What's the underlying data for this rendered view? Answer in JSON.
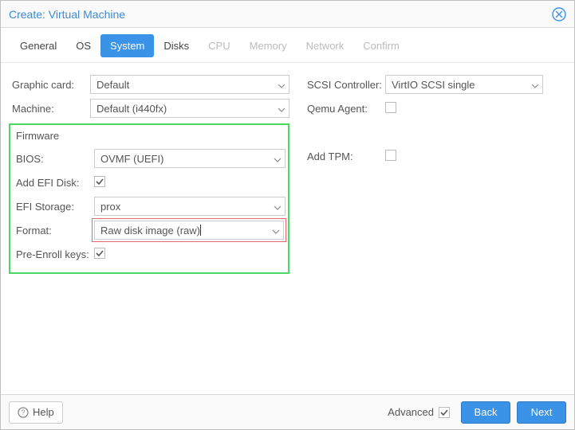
{
  "window": {
    "title": "Create: Virtual Machine"
  },
  "tabs": {
    "general": "General",
    "os": "OS",
    "system": "System",
    "disks": "Disks",
    "cpu": "CPU",
    "memory": "Memory",
    "network": "Network",
    "confirm": "Confirm"
  },
  "left": {
    "graphic_card": {
      "label": "Graphic card:",
      "value": "Default"
    },
    "machine": {
      "label": "Machine:",
      "value": "Default (i440fx)"
    }
  },
  "firmware": {
    "legend": "Firmware",
    "bios": {
      "label": "BIOS:",
      "value": "OVMF (UEFI)"
    },
    "add_efi_disk": {
      "label": "Add EFI Disk:"
    },
    "efi_storage": {
      "label": "EFI Storage:",
      "value": "prox"
    },
    "format": {
      "label": "Format:",
      "value": "Raw disk image (raw)"
    },
    "pre_enroll": {
      "label": "Pre-Enroll keys:"
    }
  },
  "right": {
    "scsi_controller": {
      "label": "SCSI Controller:",
      "value": "VirtIO SCSI single"
    },
    "qemu_agent": {
      "label": "Qemu Agent:"
    },
    "add_tpm": {
      "label": "Add TPM:"
    }
  },
  "footer": {
    "help": "Help",
    "advanced": "Advanced",
    "back": "Back",
    "next": "Next"
  }
}
